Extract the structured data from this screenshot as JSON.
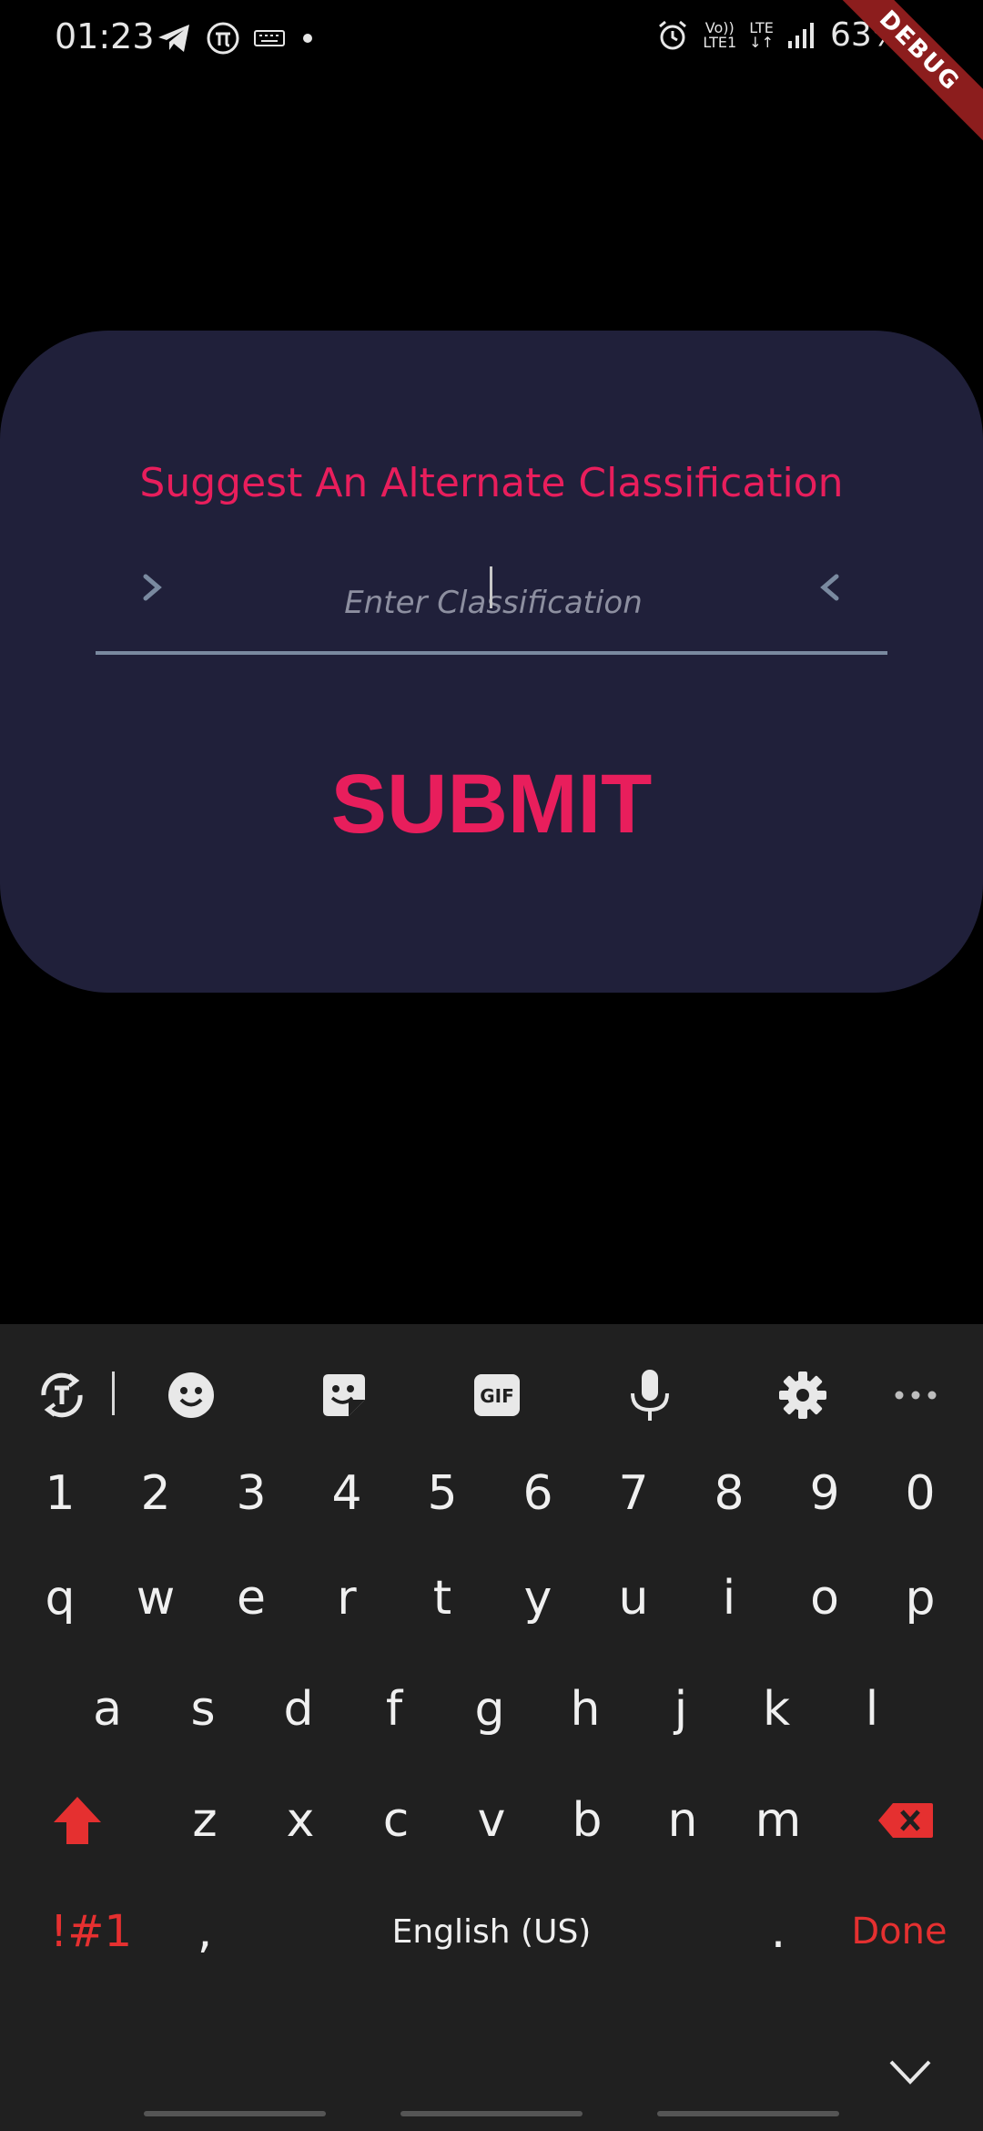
{
  "status_bar": {
    "time": "01:23",
    "network_top": "Vo))",
    "network_bottom": "LTE1",
    "lte_label": "LTE",
    "battery": "63%"
  },
  "debug_banner": "DEBUG",
  "dialog": {
    "title": "Suggest An Alternate Classification",
    "input_placeholder": "Enter Classification",
    "input_value": "",
    "submit_label": "SUBMIT",
    "accent_color": "#e81e5c",
    "background_color": "#20203a"
  },
  "keyboard": {
    "toolbar_icons": [
      "text-recognition-icon",
      "emoji-icon",
      "sticker-icon",
      "gif-icon",
      "microphone-icon",
      "settings-icon",
      "more-icon"
    ],
    "gif_label": "GIF",
    "number_row": [
      "1",
      "2",
      "3",
      "4",
      "5",
      "6",
      "7",
      "8",
      "9",
      "0"
    ],
    "row1": [
      "q",
      "w",
      "e",
      "r",
      "t",
      "y",
      "u",
      "i",
      "o",
      "p"
    ],
    "row2": [
      "a",
      "s",
      "d",
      "f",
      "g",
      "h",
      "j",
      "k",
      "l"
    ],
    "row3": [
      "z",
      "x",
      "c",
      "v",
      "b",
      "n",
      "m"
    ],
    "symbols_label": "!#1",
    "comma_label": ",",
    "space_label": "English (US)",
    "period_label": ".",
    "done_label": "Done",
    "key_accent_color": "#e53030"
  }
}
